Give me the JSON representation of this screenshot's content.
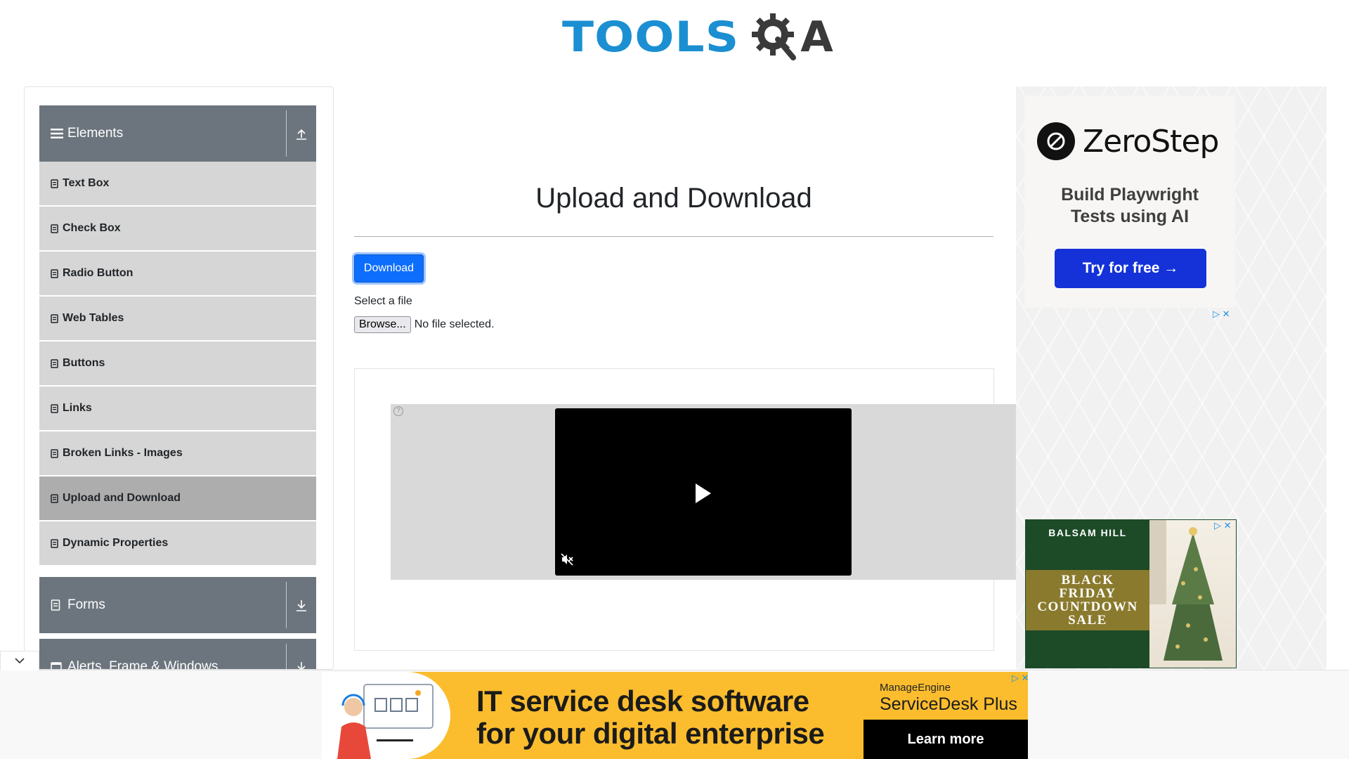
{
  "logo": {
    "text_left": "TOOLS",
    "text_right": "A",
    "gear": "gear-magnifier-q-icon"
  },
  "sidebar": {
    "groups": [
      {
        "label": "Elements",
        "icon": "hamburger-icon",
        "toggle_icon": "upload-arrow-icon"
      },
      {
        "label": "Forms",
        "icon": "document-icon",
        "toggle_icon": "download-arrow-icon"
      },
      {
        "label": "Alerts, Frame & Windows",
        "icon": "window-icon",
        "toggle_icon": "download-arrow-icon"
      }
    ],
    "items": [
      {
        "label": "Text Box"
      },
      {
        "label": "Check Box"
      },
      {
        "label": "Radio Button"
      },
      {
        "label": "Web Tables"
      },
      {
        "label": "Buttons"
      },
      {
        "label": "Links"
      },
      {
        "label": "Broken Links - Images"
      },
      {
        "label": "Upload and Download",
        "active": true
      },
      {
        "label": "Dynamic Properties"
      }
    ]
  },
  "main": {
    "title": "Upload and Download",
    "download_button": "Download",
    "select_label": "Select a file",
    "browse_button": "Browse...",
    "file_status": "No file selected."
  },
  "ads": {
    "zerostep": {
      "brand": "ZeroStep",
      "line1": "Build Playwright",
      "line2": "Tests using AI",
      "cta": "Try for free →"
    },
    "balsam": {
      "brand": "BALSAM HILL",
      "line1": "BLACK",
      "line2": "FRIDAY",
      "line3": "COUNTDOWN",
      "line4": "SALE"
    },
    "bottom": {
      "line1": "IT service desk software",
      "line2": "for your digital enterprise",
      "brand_top": "ManageEngine",
      "brand_product": "ServiceDesk Plus",
      "cta": "Learn more"
    },
    "adchoices_glyphs": "▷ ✕"
  },
  "colors": {
    "logo_blue": "#1b8fd2",
    "sidebar_header": "#6c757d",
    "menu_item": "#d6d6d6",
    "menu_item_active": "#adadad",
    "primary_button": "#0d6efd",
    "zerostep_cta": "#1432d8",
    "bottom_ad_bg": "#fbbd2e"
  }
}
